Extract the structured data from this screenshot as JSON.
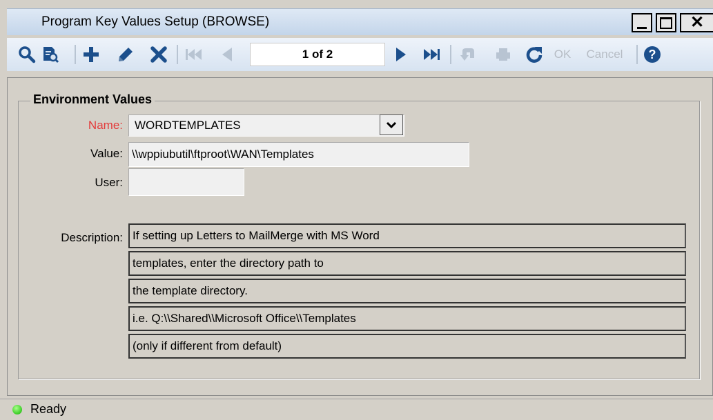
{
  "window": {
    "title": "Program Key Values Setup (BROWSE)"
  },
  "toolbar": {
    "record_position": "1 of 2",
    "ok_label": "OK",
    "cancel_label": "Cancel",
    "icons": [
      "search-icon",
      "report-preview-icon",
      "add-icon",
      "edit-icon",
      "delete-icon",
      "first-record-icon",
      "previous-record-icon",
      "next-record-icon",
      "last-record-icon",
      "undo-icon",
      "print-icon",
      "refresh-icon",
      "help-icon"
    ]
  },
  "group": {
    "title": "Environment Values"
  },
  "form": {
    "name_label": "Name:",
    "name_value": "WORDTEMPLATES",
    "value_label": "Value:",
    "value_value": "\\\\wppiubutil\\ftproot\\WAN\\Templates",
    "user_label": "User:",
    "user_value": "",
    "description_label": "Description:",
    "description_lines": [
      "If setting up Letters to MailMerge with MS Word",
      "templates, enter the directory path to",
      "the template directory.",
      "i.e.  Q:\\\\Shared\\\\Microsoft Office\\\\Templates",
      "(only if different from default)"
    ]
  },
  "status": {
    "text": "Ready"
  },
  "colors": {
    "required_label": "#e33b3b",
    "toolbar_icon": "#1c4f8c",
    "status_ok": "#3fcf2a"
  }
}
